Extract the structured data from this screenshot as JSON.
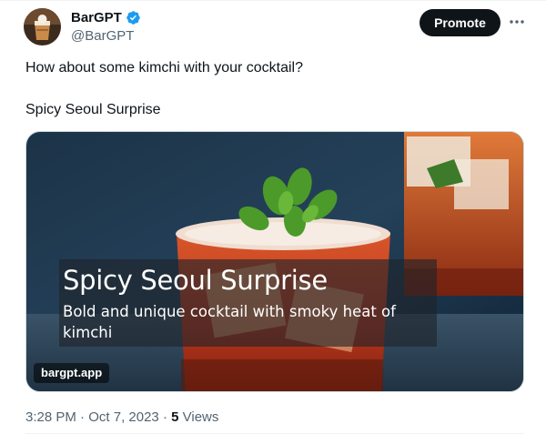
{
  "author": {
    "display_name": "BarGPT",
    "handle": "@BarGPT",
    "verified_icon": "verified-badge-icon",
    "verified_color": "#1d9bf0"
  },
  "actions": {
    "promote_label": "Promote",
    "more_icon": "more-horizontal-icon"
  },
  "tweet": {
    "text_line1": "How about some kimchi with your cocktail?",
    "text_line2": "Spicy Seoul Surprise"
  },
  "card": {
    "title": "Spicy Seoul Surprise",
    "description": "Bold and unique cocktail with smoky heat of kimchi",
    "domain": "bargpt.app"
  },
  "meta": {
    "time": "3:28 PM",
    "separator": "·",
    "date": "Oct 7, 2023",
    "views_count": "5",
    "views_label": "Views"
  },
  "colors": {
    "text_primary": "#0f1419",
    "text_secondary": "#536471",
    "promote_bg": "#0f1419"
  }
}
